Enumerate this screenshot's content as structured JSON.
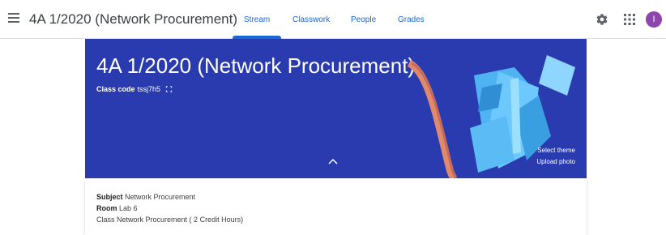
{
  "header": {
    "class_title": "4A 1/2020 (Network Procurement)",
    "tabs": [
      {
        "label": "Stream"
      },
      {
        "label": "Classwork"
      },
      {
        "label": "People"
      },
      {
        "label": "Grades"
      }
    ],
    "active_tab": "Stream",
    "avatar_initial": "I"
  },
  "icons": {
    "menu": "hamburger-menu-icon",
    "settings": "gear-icon",
    "apps": "apps-grid-icon",
    "expand": "fullscreen-icon",
    "collapse": "chevron-up-icon"
  },
  "banner": {
    "title": "4A 1/2020 (Network Procurement)",
    "class_code_label": "Class code",
    "class_code_value": "tssj7h5",
    "select_theme": "Select theme",
    "upload_photo": "Upload photo"
  },
  "details": {
    "subject_label": "Subject",
    "subject_value": "Network Procurement",
    "room_label": "Room",
    "room_value": "Lab 6",
    "class_label": "Class",
    "class_value": "Network Procurement ( 2 Credit Hours)"
  },
  "colors": {
    "banner_background": "#2a3bb0",
    "tab_accent": "#1967d2",
    "avatar": "#8e44ad"
  }
}
